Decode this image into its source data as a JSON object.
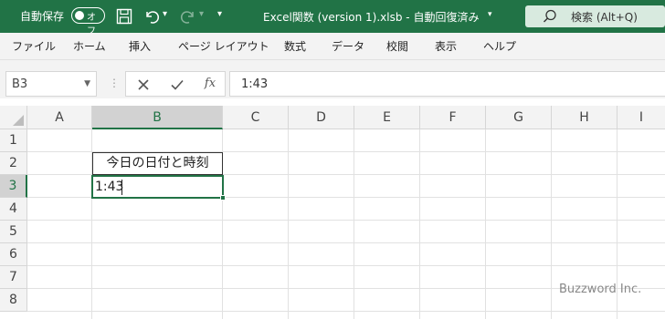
{
  "titlebar": {
    "autosave_label": "自動保存",
    "toggle_label": "オフ",
    "doc_title": "Excel関数 (version 1).xlsb - 自動回復済み",
    "search_placeholder": "検索 (Alt+Q)",
    "icons": [
      "save-icon",
      "undo-icon",
      "redo-icon",
      "customize-qat-icon",
      "search-icon"
    ],
    "accent_color": "#217346"
  },
  "ribbon": {
    "tabs": [
      "ファイル",
      "ホーム",
      "挿入",
      "ページ レイアウト",
      "数式",
      "データ",
      "校閲",
      "表示",
      "ヘルプ"
    ]
  },
  "formula_bar": {
    "name_box": "B3",
    "formula": "1:43",
    "fx_label": "fx"
  },
  "sheet": {
    "columns": [
      "A",
      "B",
      "C",
      "D",
      "E",
      "F",
      "G",
      "H",
      "I"
    ],
    "rows": [
      "1",
      "2",
      "3",
      "4",
      "5",
      "6",
      "7",
      "8"
    ],
    "selected_column": "B",
    "selected_row": "3",
    "cells": {
      "B2": "今日の日付と時刻",
      "B3": "1:43"
    }
  },
  "watermark": "Buzzword Inc."
}
